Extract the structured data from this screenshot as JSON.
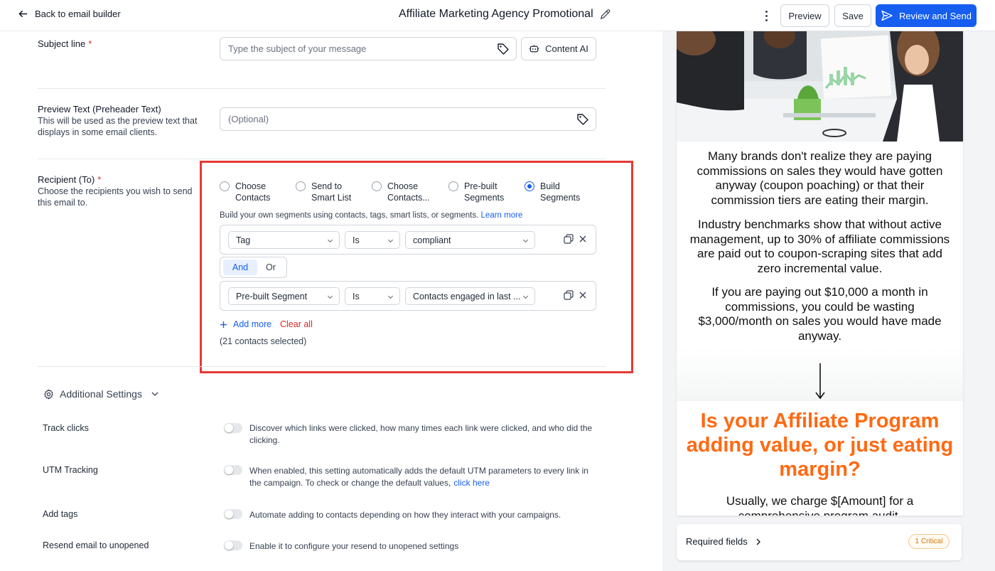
{
  "header": {
    "back_label": "Back to email builder",
    "campaign_title": "Affiliate Marketing Agency Promotional",
    "preview_label": "Preview",
    "save_label": "Save",
    "send_label": "Review and Send"
  },
  "subject": {
    "label": "Subject line",
    "required_mark": "*",
    "placeholder": "Type the subject of your message",
    "content_ai_label": "Content AI"
  },
  "preheader": {
    "label": "Preview Text (Preheader Text)",
    "description_line1": "This will be used as the preview text that",
    "description_line2": "displays in some email clients.",
    "placeholder": "(Optional)"
  },
  "recipient": {
    "label": "Recipient (To)",
    "required_mark": "*",
    "description_line1": "Choose the recipients you wish to send",
    "description_line2": "this email to.",
    "options": [
      {
        "line1": "Choose",
        "line2": "Contacts",
        "selected": false
      },
      {
        "line1": "Send to",
        "line2": "Smart List",
        "selected": false
      },
      {
        "line1": "Choose",
        "line2": "Contacts...",
        "selected": false
      },
      {
        "line1": "Pre-built",
        "line2": "Segments",
        "selected": false
      },
      {
        "line1": "Build",
        "line2": "Segments",
        "selected": true
      }
    ],
    "hint": "Build your own segments using contacts, tags, smart lists, or segments.",
    "learn_more": "Learn more",
    "rules": [
      {
        "field": "Tag",
        "operator": "Is",
        "value": "compliant"
      },
      {
        "field": "Pre-built Segment",
        "operator": "Is",
        "value": "Contacts engaged in last ..."
      }
    ],
    "and_label": "And",
    "or_label": "Or",
    "add_more": "Add more",
    "clear_all": "Clear all",
    "selected_count": "(21 contacts selected)"
  },
  "additional_settings": {
    "title": "Additional Settings",
    "items": [
      {
        "label": "Track clicks",
        "desc_line1": "Discover which links were clicked, how many times each link were clicked, and who did the",
        "desc_line2": "clicking.",
        "enabled": false
      },
      {
        "label": "UTM Tracking",
        "desc_line1": "When enabled, this setting automatically adds the default UTM parameters to every link in",
        "desc_line2": "the campaign. To check or change the default values,",
        "link": "click here",
        "enabled": false
      },
      {
        "label": "Add tags",
        "desc_line1": "Automate adding to contacts depending on how they interact with your campaigns.",
        "enabled": false
      },
      {
        "label": "Resend email to unopened",
        "desc_line1": "Enable it to configure your resend to unopened settings",
        "enabled": false
      }
    ]
  },
  "email_preview": {
    "paragraph1": "Many brands don't realize they are paying commissions on sales they would have gotten anyway (coupon poaching) or that their commission tiers are eating their margin.",
    "paragraph2": "Industry benchmarks show that without active management, up to 30% of affiliate commissions are paid out to coupon-scraping sites that add zero incremental value.",
    "paragraph3": "If you are paying out $10,000 a month in commissions, you could be wasting $3,000/month on sales you would have made anyway.",
    "headline": "Is your Affiliate Program adding value, or just eating margin?",
    "paragraph4": "Usually, we charge $[Amount] for a comprehensive program audit.",
    "headline_color": "#ff6a13"
  },
  "required_fields": {
    "label": "Required fields",
    "badge": "1 Critical"
  },
  "colors": {
    "primary": "#155eef",
    "danger": "#dc2626",
    "highlight_box": "#e53935"
  }
}
